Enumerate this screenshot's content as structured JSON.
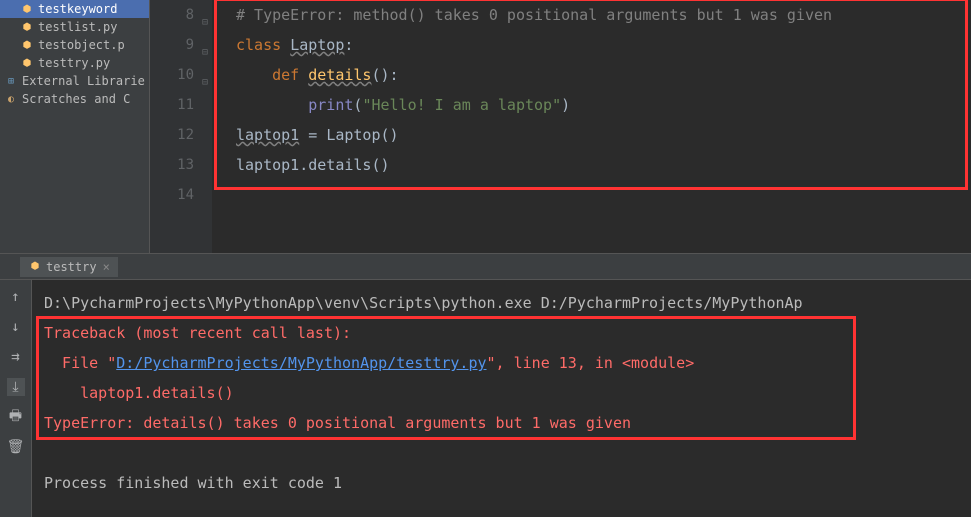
{
  "sidebar": {
    "files": [
      {
        "name": "testkeyword",
        "selected": true
      },
      {
        "name": "testlist.py",
        "selected": false
      },
      {
        "name": "testobject.p",
        "selected": false
      },
      {
        "name": "testtry.py",
        "selected": false
      }
    ],
    "libs": [
      {
        "name": "External Librarie"
      },
      {
        "name": "Scratches and C"
      }
    ]
  },
  "editor": {
    "line_numbers": [
      "8",
      "9",
      "10",
      "11",
      "12",
      "13",
      "14"
    ],
    "code": {
      "l8_comment": "# TypeError: method() takes 0 positional arguments but 1 was given",
      "l9_kw": "class ",
      "l9_cls": "Laptop",
      "l9_colon": ":",
      "l10_kw": "def ",
      "l10_fn": "details",
      "l10_paren": "():",
      "l11_fn": "print",
      "l11_paren_open": "(",
      "l11_str": "\"Hello! I am a laptop\"",
      "l11_paren_close": ")",
      "l12_var": "laptop1",
      "l12_assign": " = ",
      "l12_cls": "Laptop",
      "l12_call": "()",
      "l13_var": "laptop1",
      "l13_call": ".details()"
    }
  },
  "console": {
    "tab_name": "testtry",
    "lines": {
      "cmd": "D:\\PycharmProjects\\MyPythonApp\\venv\\Scripts\\python.exe D:/PycharmProjects/MyPythonAp",
      "traceback": "Traceback (most recent call last):",
      "file_prefix": "  File \"",
      "file_link": "D:/PycharmProjects/MyPythonApp/testtry.py",
      "file_suffix": "\", line 13, in <module>",
      "call_line": "    laptop1.details()",
      "error": "TypeError: details() takes 0 positional arguments but 1 was given",
      "exit": "Process finished with exit code 1"
    }
  }
}
